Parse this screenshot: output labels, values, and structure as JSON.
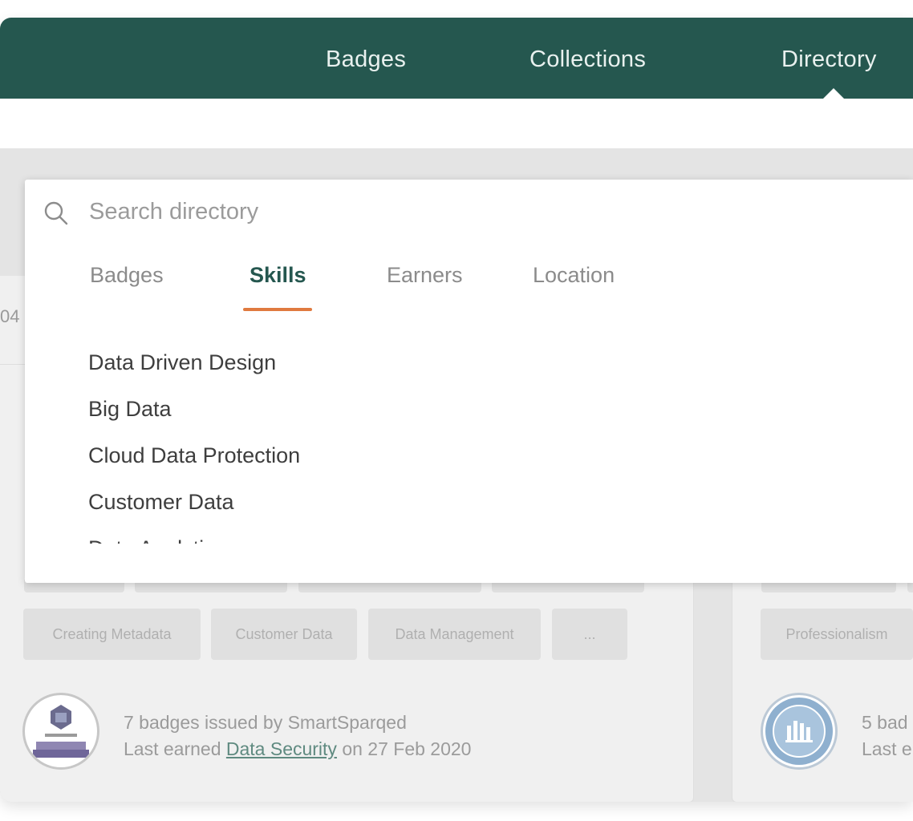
{
  "nav": {
    "links": [
      "Badges",
      "Collections",
      "Directory"
    ],
    "active": "Directory"
  },
  "background": {
    "partial_text": "04"
  },
  "card_left": {
    "chips": [
      "Creating Metadata",
      "Customer Data",
      "Data Management",
      "..."
    ],
    "issuer_line": "7 badges issued by SmartSparqed",
    "last_earned_prefix": "Last earned ",
    "last_earned_badge": "Data Security",
    "last_earned_suffix": " on 27 Feb 2020"
  },
  "card_right": {
    "chips": [
      "Professionalism"
    ],
    "issuer_line_partial": "5 bad",
    "last_earned_partial": "Last e"
  },
  "search": {
    "placeholder": "Search directory",
    "tabs": [
      "Badges",
      "Skills",
      "Earners",
      "Location"
    ],
    "active_tab": "Skills",
    "results": [
      "Data Driven Design",
      "Big Data",
      "Cloud Data Protection",
      "Customer Data",
      "Data Analytics"
    ]
  },
  "colors": {
    "nav_bg": "#25574f",
    "accent": "#e07a3f"
  }
}
